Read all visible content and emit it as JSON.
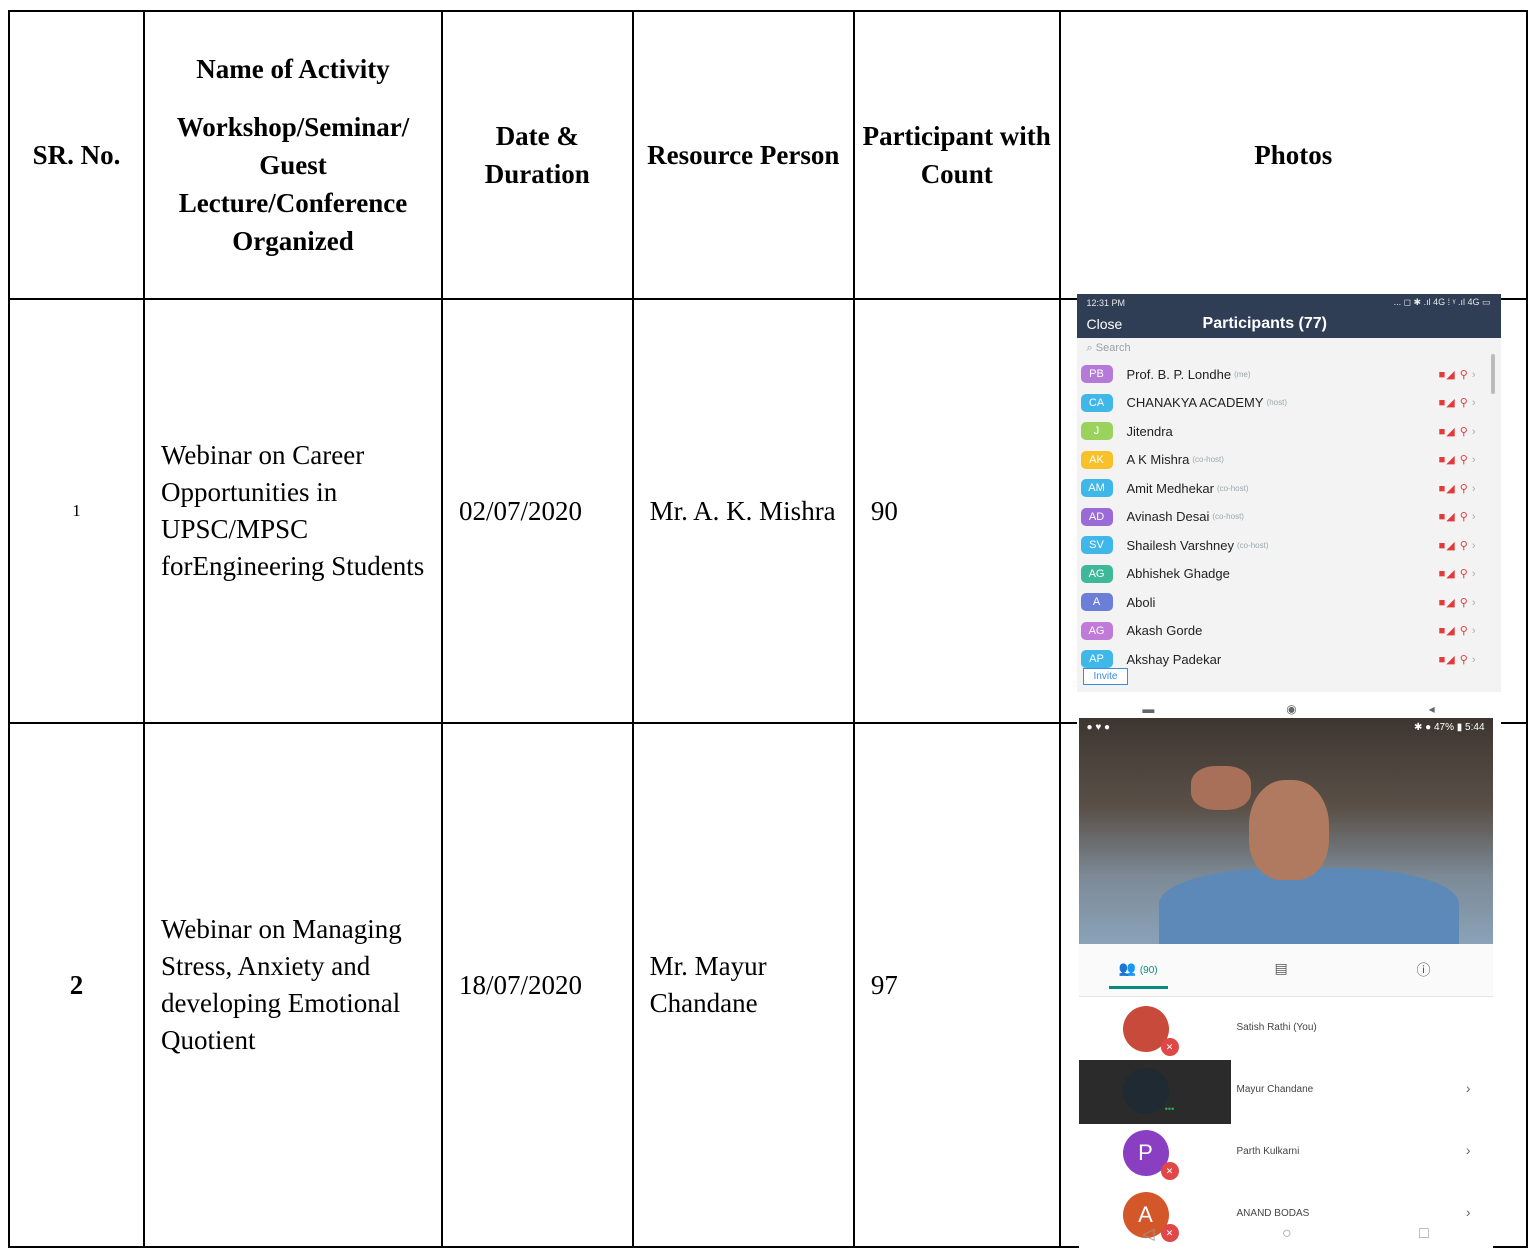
{
  "table": {
    "headers": {
      "sr": "SR. No.",
      "activity_line1": "Name of Activity",
      "activity_line2": "Workshop/Seminar/ Guest Lecture/Conference Organized",
      "date": "Date & Duration",
      "resource": "Resource Person",
      "participant": "Participant with Count",
      "photos": "Photos"
    },
    "rows": [
      {
        "sr": "1",
        "activity": "Webinar on Career Opportunities in UPSC/MPSC forEngineering Students",
        "date": "02/07/2020",
        "resource": "Mr. A. K. Mishra",
        "count": "90"
      },
      {
        "sr": "2",
        "activity": "Webinar on Managing Stress, Anxiety and developing Emotional Quotient",
        "date": "18/07/2020",
        "resource": "Mr. Mayur Chandane",
        "count": "97"
      }
    ]
  },
  "photo1": {
    "time": "12:31 PM",
    "status_right": "... ◻ ✱ .ıl 4G ⁞ ᵞ .ıl 4G ▭",
    "close": "Close",
    "title": "Participants (77)",
    "search": "Search",
    "invite": "Invite",
    "participants": [
      {
        "initials": "PB",
        "name": "Prof. B. P. Londhe",
        "tag": "(me)",
        "color": "#b57ad8"
      },
      {
        "initials": "CA",
        "name": "CHANAKYA ACADEMY",
        "tag": "(host)",
        "color": "#3fb7e8"
      },
      {
        "initials": "J",
        "name": "Jitendra",
        "tag": "",
        "color": "#9bd25b"
      },
      {
        "initials": "AK",
        "name": "A K Mishra",
        "tag": "(co-host)",
        "color": "#f6c12a"
      },
      {
        "initials": "AM",
        "name": "Amit Medhekar",
        "tag": "(co-host)",
        "color": "#3fb7e8"
      },
      {
        "initials": "AD",
        "name": "Avinash Desai",
        "tag": "(co-host)",
        "color": "#9a6bd6"
      },
      {
        "initials": "SV",
        "name": "Shailesh Varshney",
        "tag": "(co-host)",
        "color": "#3fb7e8"
      },
      {
        "initials": "AG",
        "name": "Abhishek Ghadge",
        "tag": "",
        "color": "#3fb89a"
      },
      {
        "initials": "A",
        "name": "Aboli",
        "tag": "",
        "color": "#6b7fd8"
      },
      {
        "initials": "AG",
        "name": "Akash Gorde",
        "tag": "",
        "color": "#c07ad8"
      },
      {
        "initials": "AP",
        "name": "Akshay Padekar",
        "tag": "",
        "color": "#3fb7e8"
      }
    ]
  },
  "photo2": {
    "status_left": "● ♥ ●",
    "status_right": "✱ ● 47% ▮ 5:44",
    "tab_participants": "(90)",
    "participants": [
      {
        "initial": "",
        "name": "Satish Rathi (You)",
        "color": "#c84a3a"
      },
      {
        "initial": "",
        "name": "Mayur Chandane",
        "color": "#1f2a33"
      },
      {
        "initial": "P",
        "name": "Parth Kulkarni",
        "color": "#8a3fc2"
      },
      {
        "initial": "A",
        "name": "ANAND BODAS",
        "color": "#d4572a"
      }
    ]
  }
}
